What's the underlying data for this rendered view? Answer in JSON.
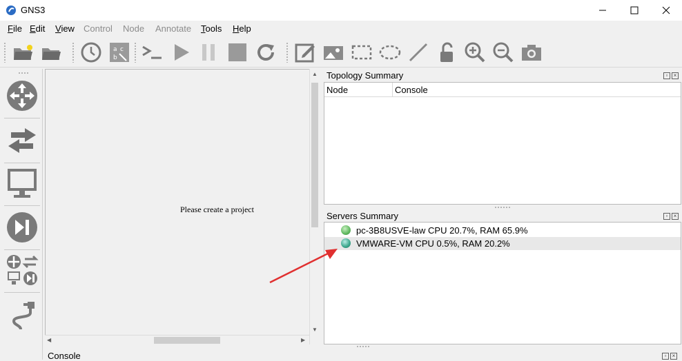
{
  "window": {
    "title": "GNS3"
  },
  "menu": {
    "file": "ile",
    "file_u": "F",
    "edit": "dit",
    "edit_u": "E",
    "view": "iew",
    "view_u": "V",
    "control": "Control",
    "node": "Node",
    "annotate": "Annotate",
    "tools": "ools",
    "tools_u": "T",
    "help": "elp",
    "help_u": "H"
  },
  "canvas": {
    "message": "Please create a project"
  },
  "topology": {
    "title": "Topology Summary",
    "columns": [
      "Node",
      "Console"
    ]
  },
  "servers": {
    "title": "Servers Summary",
    "items": [
      {
        "label": "pc-3B8USVE-law CPU 20.7%, RAM 65.9%",
        "status_color": "#5fb85f"
      },
      {
        "label": "VMWARE-VM CPU 0.5%, RAM 20.2%",
        "status_color": "#3aa58a"
      }
    ]
  },
  "console": {
    "title": "Console"
  },
  "colors": {
    "annotation_arrow": "#e03030",
    "icon_gray": "#7a7a7a"
  }
}
